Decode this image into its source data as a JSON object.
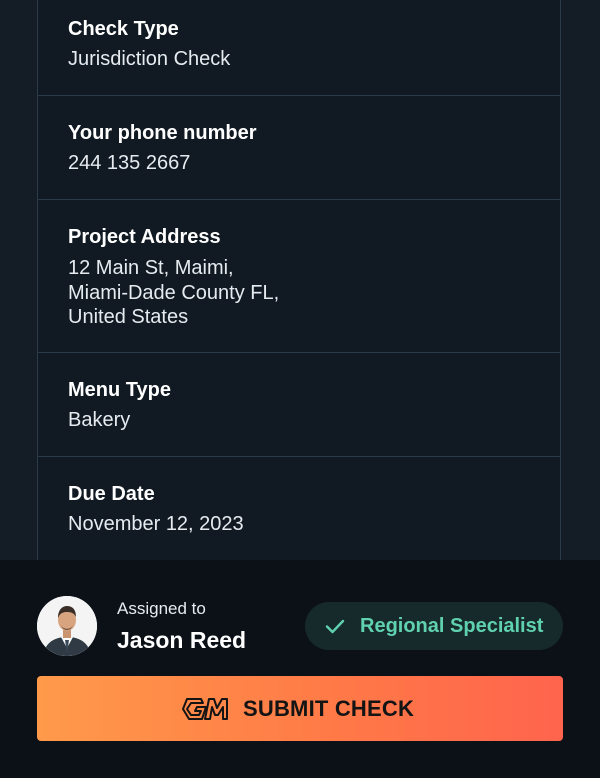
{
  "details": [
    {
      "label": "Check Type",
      "value": "Jurisdiction Check"
    },
    {
      "label": "Your phone number",
      "value": "244 135 2667"
    },
    {
      "label": "Project Address",
      "value": "12 Main St, Maimi,\nMiami-Dade County FL,\nUnited States"
    },
    {
      "label": "Menu Type",
      "value": "Bakery"
    },
    {
      "label": "Due Date",
      "value": "November 12, 2023"
    }
  ],
  "assignment": {
    "assigned_label": "Assigned to",
    "assignee_name": "Jason Reed",
    "badge_label": "Regional Specialist",
    "badge_icon": "check-icon"
  },
  "submit": {
    "label": "SUBMIT CHECK",
    "icon": "gm-logo-icon"
  },
  "colors": {
    "background": "#141c25",
    "card": "#111a23",
    "footer": "#0c1117",
    "badge_bg": "#172a2b",
    "badge_text": "#5fd1ae",
    "submit_gradient_start": "#ff9a4a",
    "submit_gradient_end": "#ff644d"
  }
}
